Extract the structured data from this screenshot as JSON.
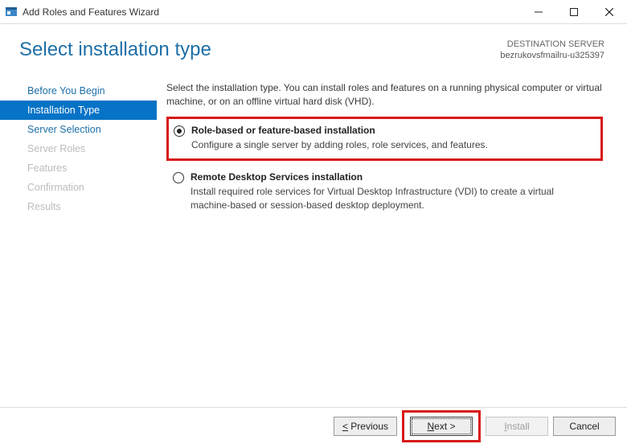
{
  "window": {
    "title": "Add Roles and Features Wizard"
  },
  "header": {
    "page_title": "Select installation type",
    "destination_label": "DESTINATION SERVER",
    "destination_value": "bezrukovsfmailru-u325397"
  },
  "sidebar": {
    "items": [
      {
        "label": "Before You Begin",
        "state": "enabled"
      },
      {
        "label": "Installation Type",
        "state": "active"
      },
      {
        "label": "Server Selection",
        "state": "enabled"
      },
      {
        "label": "Server Roles",
        "state": "disabled"
      },
      {
        "label": "Features",
        "state": "disabled"
      },
      {
        "label": "Confirmation",
        "state": "disabled"
      },
      {
        "label": "Results",
        "state": "disabled"
      }
    ]
  },
  "content": {
    "intro": "Select the installation type. You can install roles and features on a running physical computer or virtual machine, or on an offline virtual hard disk (VHD).",
    "options": [
      {
        "title": "Role-based or feature-based installation",
        "desc": "Configure a single server by adding roles, role services, and features.",
        "selected": true,
        "highlighted": true
      },
      {
        "title": "Remote Desktop Services installation",
        "desc": "Install required role services for Virtual Desktop Infrastructure (VDI) to create a virtual machine-based or session-based desktop deployment.",
        "selected": false,
        "highlighted": false
      }
    ]
  },
  "footer": {
    "previous": "< Previous",
    "next": "Next >",
    "install": "Install",
    "cancel": "Cancel"
  }
}
